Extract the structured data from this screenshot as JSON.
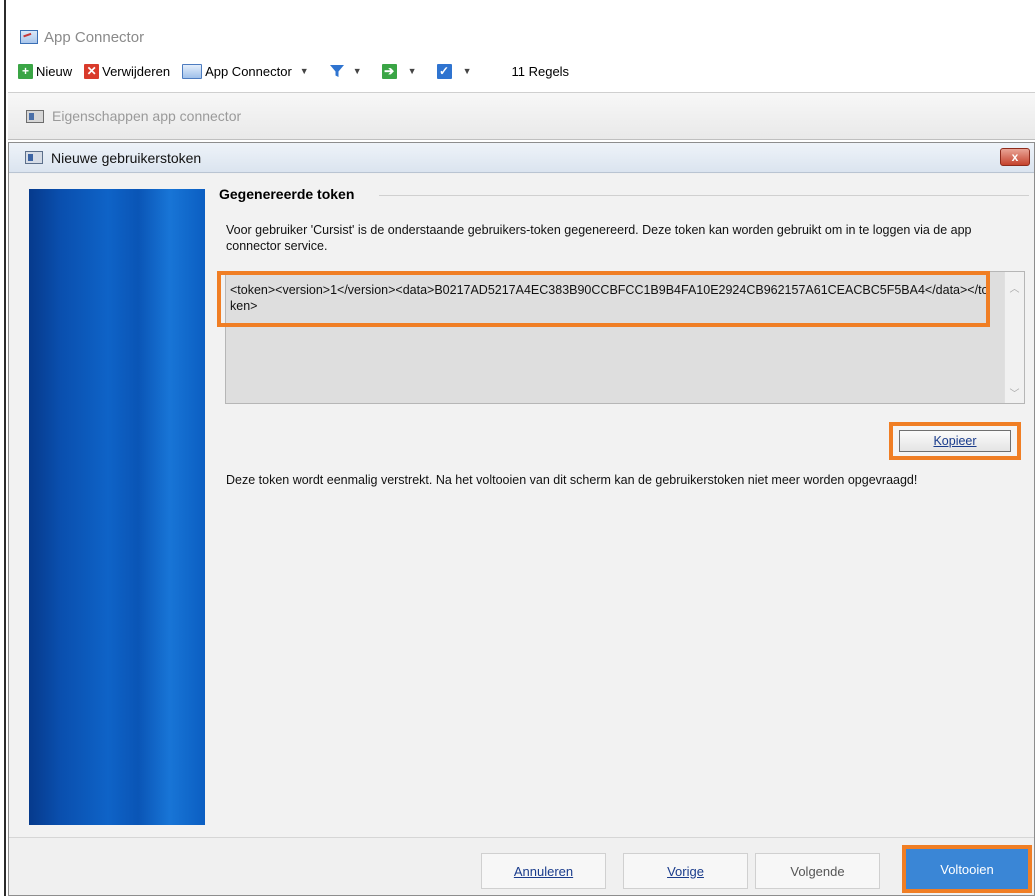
{
  "app": {
    "title": "App Connector"
  },
  "toolbar": {
    "new_label": "Nieuw",
    "delete_label": "Verwijderen",
    "connector_label": "App Connector",
    "rules_count": "11 Regels"
  },
  "properties_bar": {
    "title": "Eigenschappen app connector"
  },
  "dialog": {
    "title": "Nieuwe gebruikerstoken",
    "close_glyph": "x",
    "section_title": "Gegenereerde token",
    "description": "Voor gebruiker 'Cursist' is de onderstaande gebruikers-token gegenereerd. Deze token kan worden gebruikt om in te loggen via de app connector service.",
    "token": "<token><version>1</version><data>B0217AD5217A4EC383B90CCBFCC1B9B4FA10E2924CB962157A61CEACBC5F5BA4</data></token>",
    "copy_label": "Kopieer",
    "warning": "Deze token wordt eenmalig verstrekt. Na het voltooien van dit scherm kan de gebruikerstoken niet meer worden opgevraagd!",
    "buttons": {
      "cancel": "Annuleren",
      "previous": "Vorige",
      "next": "Volgende",
      "finish": "Voltooien"
    }
  },
  "colors": {
    "highlight": "#f07e24",
    "finish_button": "#3a86d6",
    "banner": "#0a55b6"
  }
}
